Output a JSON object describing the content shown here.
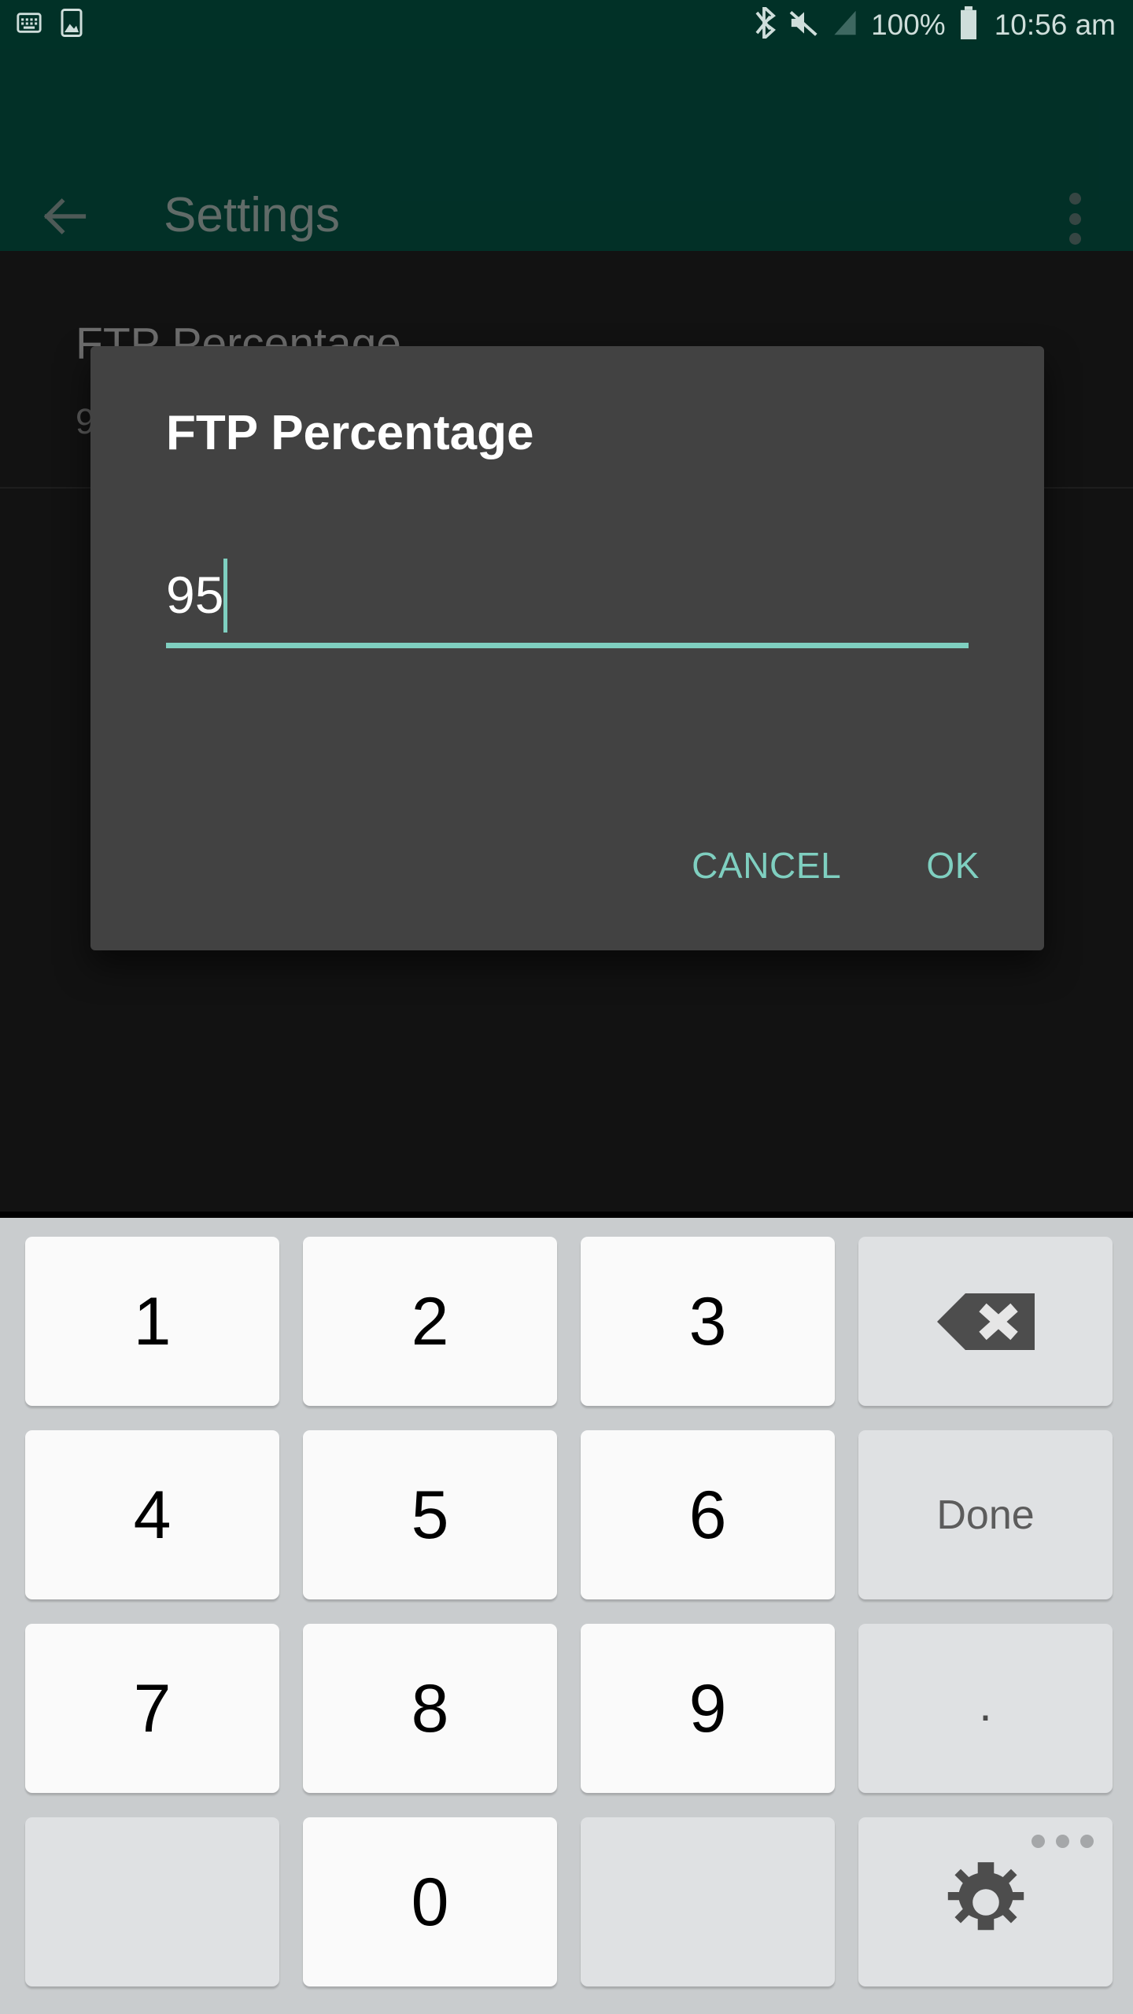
{
  "status_bar": {
    "left_icons": [
      {
        "name": "keyboard-icon",
        "glyph": "keyboard"
      },
      {
        "name": "image-icon",
        "glyph": "image"
      }
    ],
    "right_icons": [
      {
        "name": "bluetooth-icon",
        "glyph": "bluetooth"
      },
      {
        "name": "volume-mute-icon",
        "glyph": "mute"
      },
      {
        "name": "cellular-signal-icon",
        "glyph": "signal"
      }
    ],
    "battery_percent": "100%",
    "battery_icon": "battery-full-icon",
    "clock": "10:56 am",
    "background_color": "#013127",
    "foreground_color": "#cfdedb"
  },
  "toolbar": {
    "back_icon": "back-arrow-icon",
    "title": "Settings",
    "overflow_icon": "overflow-menu-icon",
    "background_color": "#034539"
  },
  "content": {
    "preference": {
      "title": "FTP Percentage",
      "summary": "9"
    },
    "background_color": "#121212"
  },
  "dialog": {
    "title": "FTP Percentage",
    "input": {
      "value": "95",
      "placeholder": "",
      "accent_color": "#7fcfc0"
    },
    "buttons": {
      "cancel": "CANCEL",
      "ok": "OK"
    },
    "background_color": "#424242"
  },
  "keyboard": {
    "background_color": "#c9ccce",
    "rows": [
      [
        {
          "name": "key-1",
          "label": "1",
          "type": "num"
        },
        {
          "name": "key-2",
          "label": "2",
          "type": "num"
        },
        {
          "name": "key-3",
          "label": "3",
          "type": "num"
        },
        {
          "name": "key-backspace",
          "label": "",
          "type": "func",
          "icon": "backspace-icon"
        }
      ],
      [
        {
          "name": "key-4",
          "label": "4",
          "type": "num"
        },
        {
          "name": "key-5",
          "label": "5",
          "type": "num"
        },
        {
          "name": "key-6",
          "label": "6",
          "type": "num"
        },
        {
          "name": "key-done",
          "label": "Done",
          "type": "func"
        }
      ],
      [
        {
          "name": "key-7",
          "label": "7",
          "type": "num"
        },
        {
          "name": "key-8",
          "label": "8",
          "type": "num"
        },
        {
          "name": "key-9",
          "label": "9",
          "type": "num"
        },
        {
          "name": "key-period",
          "label": ".",
          "type": "func"
        }
      ],
      [
        {
          "name": "key-blank-left",
          "label": "",
          "type": "blank"
        },
        {
          "name": "key-0",
          "label": "0",
          "type": "num"
        },
        {
          "name": "key-blank-right",
          "label": "",
          "type": "blank"
        },
        {
          "name": "key-settings",
          "label": "",
          "type": "func",
          "icon": "gear-icon"
        }
      ]
    ]
  }
}
